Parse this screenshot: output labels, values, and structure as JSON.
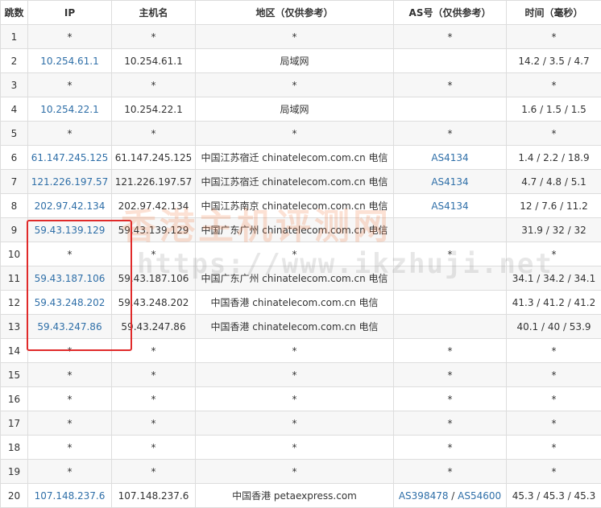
{
  "headers": {
    "hop": "跳数",
    "ip": "IP",
    "host": "主机名",
    "region": "地区（仅供参考）",
    "as": "AS号（仅供参考）",
    "time": "时间（毫秒）"
  },
  "rows": [
    {
      "hop": "1",
      "ip": "*",
      "host": "*",
      "region": "*",
      "as": "*",
      "time": "*"
    },
    {
      "hop": "2",
      "ip": "10.254.61.1",
      "host": "10.254.61.1",
      "region": "局域网",
      "as": "",
      "time": "14.2 / 3.5 / 4.7"
    },
    {
      "hop": "3",
      "ip": "*",
      "host": "*",
      "region": "*",
      "as": "*",
      "time": "*"
    },
    {
      "hop": "4",
      "ip": "10.254.22.1",
      "host": "10.254.22.1",
      "region": "局域网",
      "as": "",
      "time": "1.6 / 1.5 / 1.5"
    },
    {
      "hop": "5",
      "ip": "*",
      "host": "*",
      "region": "*",
      "as": "*",
      "time": "*"
    },
    {
      "hop": "6",
      "ip": "61.147.245.125",
      "host": "61.147.245.125",
      "region": "中国江苏宿迁 chinatelecom.com.cn 电信",
      "as": "AS4134",
      "time": "1.4 / 2.2 / 18.9"
    },
    {
      "hop": "7",
      "ip": "121.226.197.57",
      "host": "121.226.197.57",
      "region": "中国江苏宿迁 chinatelecom.com.cn 电信",
      "as": "AS4134",
      "time": "4.7 / 4.8 / 5.1"
    },
    {
      "hop": "8",
      "ip": "202.97.42.134",
      "host": "202.97.42.134",
      "region": "中国江苏南京 chinatelecom.com.cn 电信",
      "as": "AS4134",
      "time": "12 / 7.6 / 11.2"
    },
    {
      "hop": "9",
      "ip": "59.43.139.129",
      "host": "59.43.139.129",
      "region": "中国广东广州 chinatelecom.com.cn 电信",
      "as": "",
      "time": "31.9 / 32 / 32"
    },
    {
      "hop": "10",
      "ip": "*",
      "host": "*",
      "region": "*",
      "as": "*",
      "time": "*"
    },
    {
      "hop": "11",
      "ip": "59.43.187.106",
      "host": "59.43.187.106",
      "region": "中国广东广州 chinatelecom.com.cn 电信",
      "as": "",
      "time": "34.1 / 34.2 / 34.1"
    },
    {
      "hop": "12",
      "ip": "59.43.248.202",
      "host": "59.43.248.202",
      "region": "中国香港 chinatelecom.com.cn 电信",
      "as": "",
      "time": "41.3 / 41.2 / 41.2"
    },
    {
      "hop": "13",
      "ip": "59.43.247.86",
      "host": "59.43.247.86",
      "region": "中国香港 chinatelecom.com.cn 电信",
      "as": "",
      "time": "40.1 / 40 / 53.9"
    },
    {
      "hop": "14",
      "ip": "*",
      "host": "*",
      "region": "*",
      "as": "*",
      "time": "*"
    },
    {
      "hop": "15",
      "ip": "*",
      "host": "*",
      "region": "*",
      "as": "*",
      "time": "*"
    },
    {
      "hop": "16",
      "ip": "*",
      "host": "*",
      "region": "*",
      "as": "*",
      "time": "*"
    },
    {
      "hop": "17",
      "ip": "*",
      "host": "*",
      "region": "*",
      "as": "*",
      "time": "*"
    },
    {
      "hop": "18",
      "ip": "*",
      "host": "*",
      "region": "*",
      "as": "*",
      "time": "*"
    },
    {
      "hop": "19",
      "ip": "*",
      "host": "*",
      "region": "*",
      "as": "*",
      "time": "*"
    },
    {
      "hop": "20",
      "ip": "107.148.237.6",
      "host": "107.148.237.6",
      "region": "中国香港 petaexpress.com",
      "as_list": [
        "AS398478",
        "AS54600"
      ],
      "as_separator": " / ",
      "time": "45.3 / 45.3 / 45.3"
    }
  ],
  "watermark": {
    "title": "香港主机评测网",
    "url": "https://www.ikzhuji.net"
  },
  "colors": {
    "link": "#2f6fa8",
    "highlight_border": "#e02a2a",
    "stripe": "#f7f7f7",
    "grid": "#dddddd"
  }
}
